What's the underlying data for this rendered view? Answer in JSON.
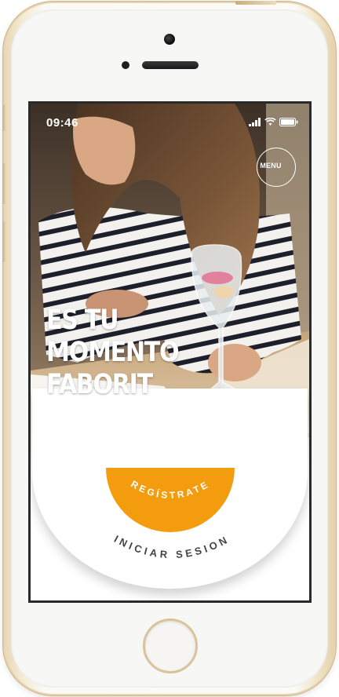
{
  "status_bar": {
    "time": "09:46",
    "icons": [
      "signal-icon",
      "wifi-icon",
      "battery-icon"
    ]
  },
  "menu": {
    "label": "MENU"
  },
  "hero": {
    "line1": "ES TU",
    "line2": "MOMENTO",
    "line3": "FABORIT"
  },
  "actions": {
    "signup_label": "REGÍSTRATE",
    "login_label": "INICIAR SESION"
  },
  "colors": {
    "accent": "#f39c0e",
    "login_text": "#444444",
    "device_frame": "#e6d4b0"
  }
}
